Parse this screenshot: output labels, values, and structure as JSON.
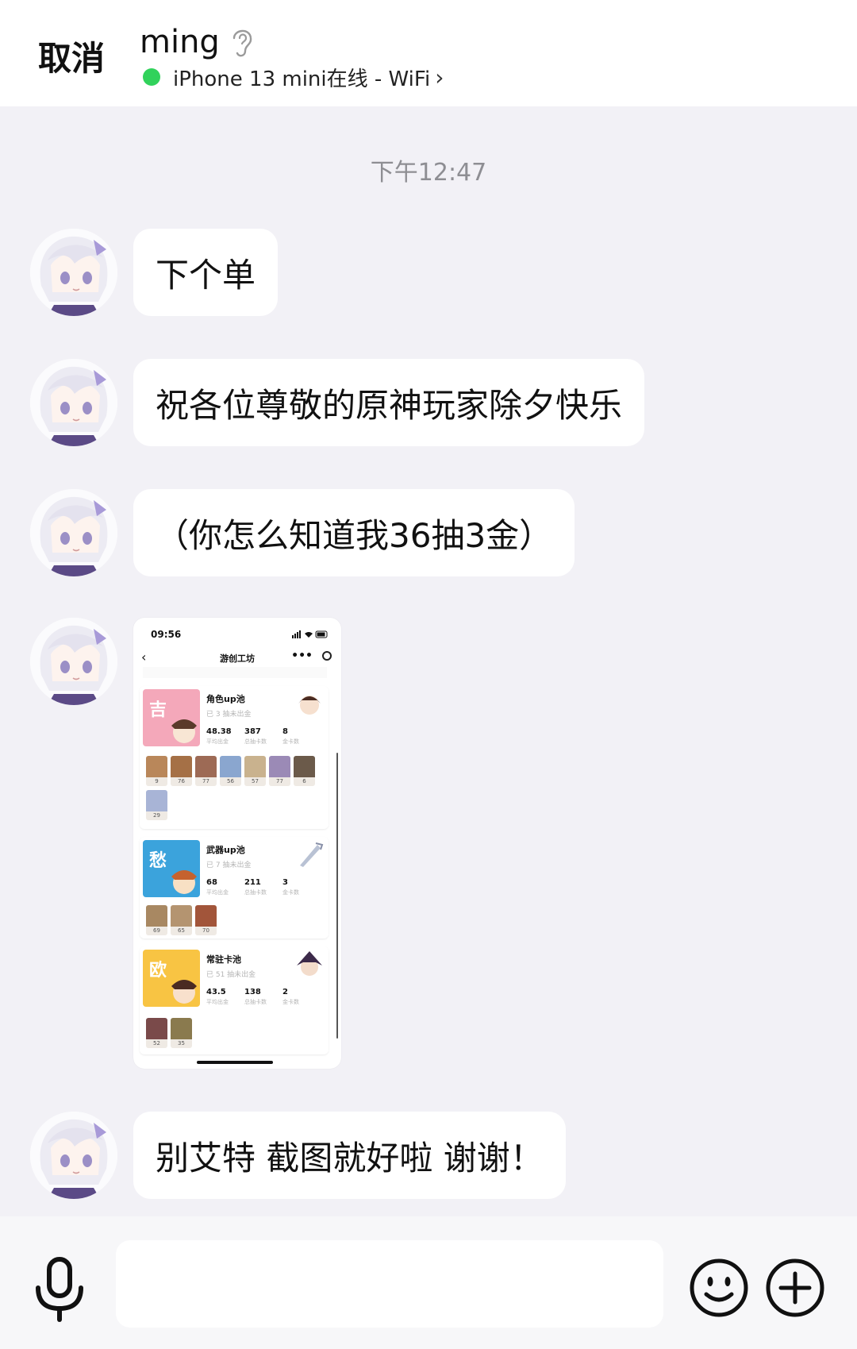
{
  "header": {
    "cancel_label": "取消",
    "contact_name": "ming",
    "status_text": "iPhone 13 mini在线 - WiFi",
    "status_color": "#31d25b"
  },
  "chat": {
    "timestamp": "下午12:47",
    "messages": [
      {
        "text": "下个单"
      },
      {
        "text": "祝各位尊敬的原神玩家除夕快乐"
      },
      {
        "text": "（你怎么知道我36抽3金）"
      },
      {
        "text": "别艾特 截图就好啦 谢谢！"
      }
    ]
  },
  "screenshot": {
    "time": "09:56",
    "app_title": "游创工坊",
    "more_label": "•••",
    "pools": [
      {
        "tile_char": "吉",
        "tile_color": "#f4a8ba",
        "title": "角色up池",
        "sub": "已 3 抽未出金",
        "stats": [
          {
            "value": "48.38",
            "label": "平均出金"
          },
          {
            "value": "387",
            "label": "总抽卡数"
          },
          {
            "value": "8",
            "label": "金卡数"
          }
        ],
        "pulls": [
          "9",
          "76",
          "77",
          "56",
          "57",
          "77",
          "6",
          "29"
        ]
      },
      {
        "tile_char": "愁",
        "tile_color": "#3ba3dc",
        "title": "武器up池",
        "sub": "已 7 抽未出金",
        "stats": [
          {
            "value": "68",
            "label": "平均出金"
          },
          {
            "value": "211",
            "label": "总抽卡数"
          },
          {
            "value": "3",
            "label": "金卡数"
          }
        ],
        "pulls": [
          "69",
          "65",
          "70"
        ]
      },
      {
        "tile_char": "欧",
        "tile_color": "#f8c443",
        "title": "常驻卡池",
        "sub": "已 51 抽未出金",
        "stats": [
          {
            "value": "43.5",
            "label": "平均出金"
          },
          {
            "value": "138",
            "label": "总抽卡数"
          },
          {
            "value": "2",
            "label": "金卡数"
          }
        ],
        "pulls": [
          "52",
          "35"
        ]
      }
    ]
  },
  "input": {
    "mic_icon": "microphone-icon",
    "emoji_icon": "smiley-icon",
    "plus_icon": "plus-circle-icon"
  }
}
